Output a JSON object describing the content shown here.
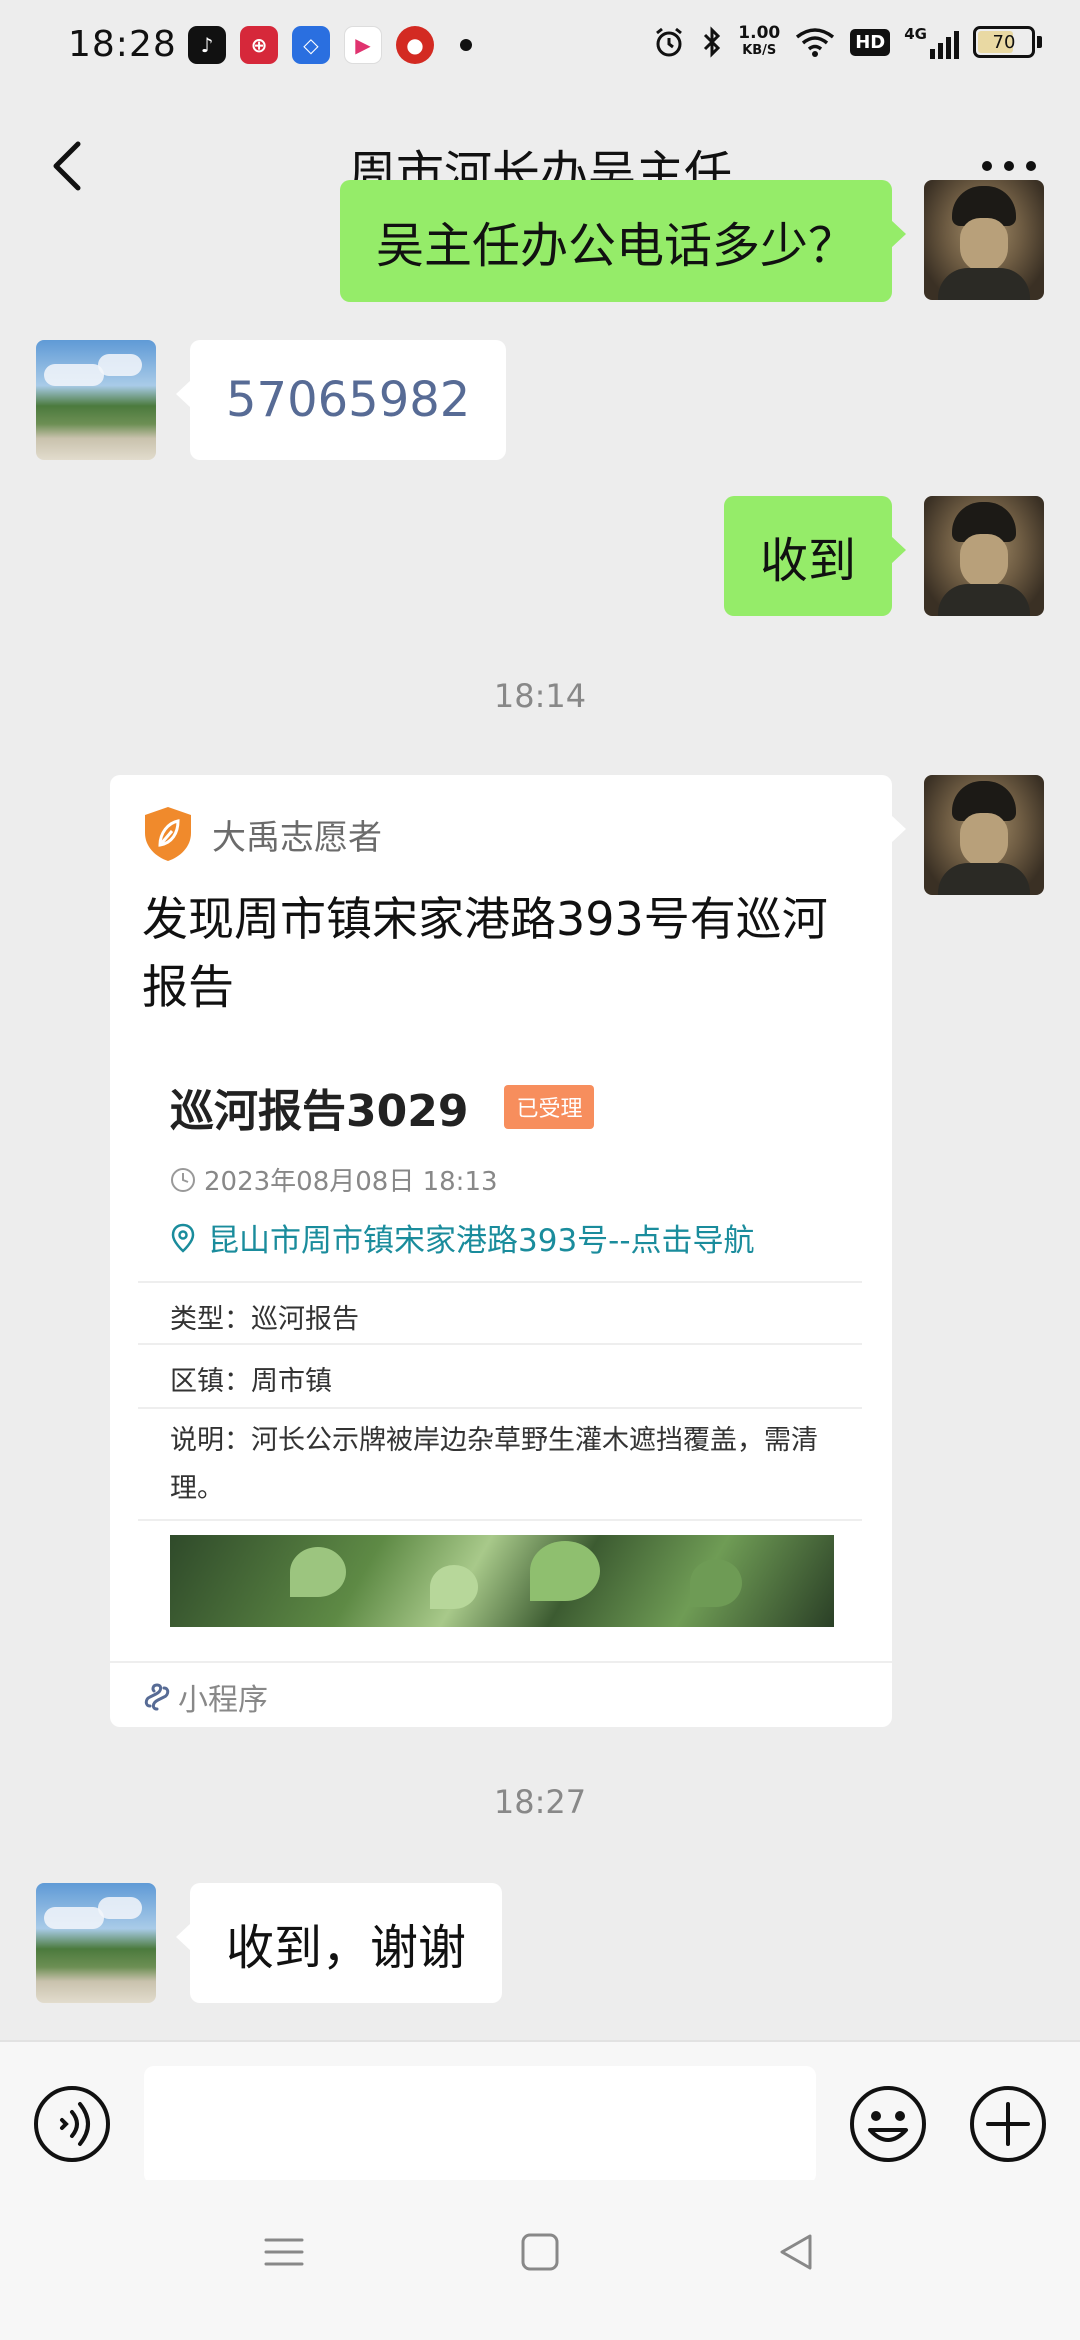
{
  "status_bar": {
    "time": "18:28",
    "net_speed_value": "1.00",
    "net_speed_unit": "KB/S",
    "hd": "HD",
    "network": "4G",
    "battery": "70",
    "battery_level": 0.7,
    "app_icons": [
      "douyin-icon",
      "yunshanfu-icon",
      "alipay-like-icon",
      "video-icon",
      "app-red-icon"
    ]
  },
  "header": {
    "title": "周市河长办吴主任",
    "back_icon": "chevron-left-icon",
    "more_icon": "more-dots-icon"
  },
  "messages": [
    {
      "type": "text",
      "direction": "out",
      "text": "吴主任办公电话多少？"
    },
    {
      "type": "text",
      "direction": "in",
      "text": "57065982"
    },
    {
      "type": "text",
      "direction": "out",
      "text": "收到"
    },
    {
      "type": "time",
      "text": "18:14"
    },
    {
      "type": "miniprogram",
      "direction": "out",
      "brand": "大禹志愿者",
      "title": "发现周市镇宋家港路393号有巡河报告",
      "report": {
        "title": "巡河报告3029",
        "status": "已受理",
        "time": "2023年08月08日 18:13",
        "address": "昆山市周市镇宋家港路393号--点击导航",
        "type_label": "类型：",
        "type_value": "巡河报告",
        "district_label": "区镇：",
        "district_value": "周市镇",
        "desc_label": "说明：",
        "desc_value": "河长公示牌被岸边杂草野生灌木遮挡覆盖，需清理。"
      },
      "footer": "小程序"
    },
    {
      "type": "time",
      "text": "18:27"
    },
    {
      "type": "text",
      "direction": "in",
      "text": "收到，谢谢"
    }
  ],
  "input_bar": {
    "placeholder": "",
    "voice_icon": "voice-icon",
    "emoji_icon": "emoji-icon",
    "plus_icon": "plus-circle-icon"
  },
  "nav_bar": {
    "icons": [
      "menu-icon",
      "home-square-icon",
      "back-triangle-icon"
    ]
  },
  "colors": {
    "background": "#ededed",
    "outgoing_bubble": "#95ec69",
    "incoming_bubble": "#ffffff",
    "phone_link": "#576b95",
    "badge": "#f78e5d",
    "address": "#1a8c9c",
    "brand_orange": "#f08a2c"
  }
}
